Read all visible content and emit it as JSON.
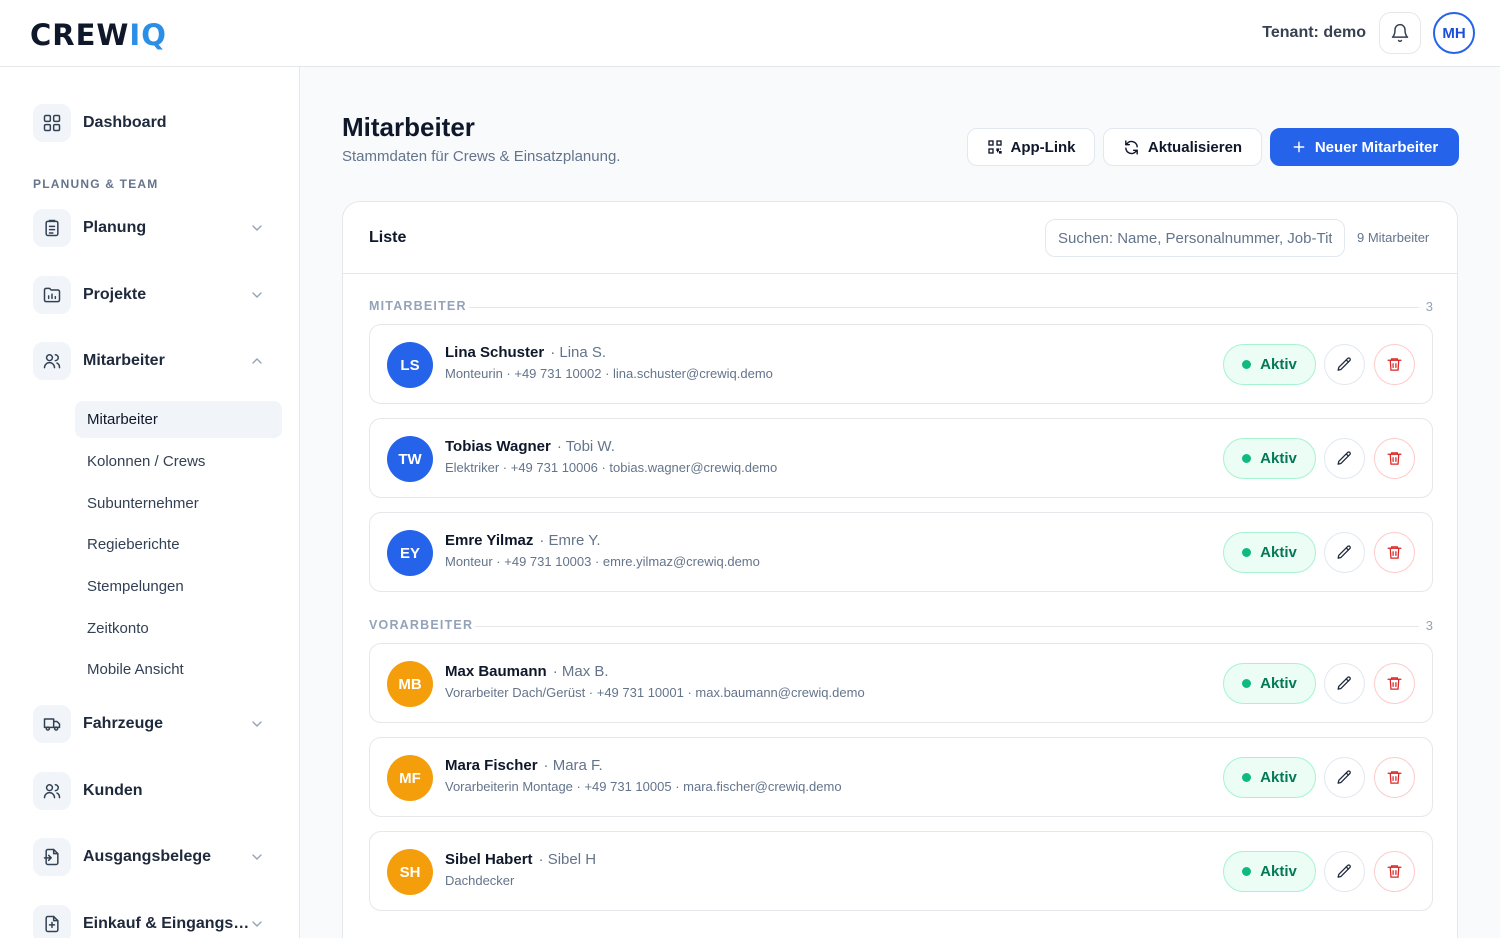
{
  "header": {
    "logo_part1": "CREW",
    "logo_part2": "IQ",
    "tenant": "Tenant: demo",
    "user_initials": "MH"
  },
  "sidebar": {
    "dashboard": "Dashboard",
    "section_label": "PLANUNG & TEAM",
    "items": [
      {
        "label": "Planung",
        "icon": "clipboard-icon"
      },
      {
        "label": "Projekte",
        "icon": "folder-chart-icon"
      },
      {
        "label": "Mitarbeiter",
        "icon": "users-icon",
        "expanded": true
      },
      {
        "label": "Fahrzeuge",
        "icon": "truck-icon"
      },
      {
        "label": "Kunden",
        "icon": "users-icon"
      },
      {
        "label": "Ausgangsbelege",
        "icon": "document-out-icon"
      },
      {
        "label": "Einkauf & Eingangsbel...",
        "icon": "document-in-icon"
      }
    ],
    "subitems": [
      "Mitarbeiter",
      "Kolonnen / Crews",
      "Subunternehmer",
      "Regieberichte",
      "Stempelungen",
      "Zeitkonto",
      "Mobile Ansicht"
    ]
  },
  "page": {
    "title": "Mitarbeiter",
    "subtitle": "Stammdaten für Crews & Einsatzplanung.",
    "btn_app_link": "App-Link",
    "btn_refresh": "Aktualisieren",
    "btn_new": "Neuer Mitarbeiter"
  },
  "list": {
    "title": "Liste",
    "search_placeholder": "Suchen: Name, Personalnummer, Job-Titel",
    "count": "9 Mitarbeiter",
    "groups": [
      {
        "label": "MITARBEITER",
        "count": "3",
        "rows": [
          {
            "initials": "LS",
            "name": "Lina Schuster",
            "nick": "· Lina S.",
            "meta": "Monteurin · +49 731 10002 · lina.schuster@crewiq.demo",
            "status": "Aktiv"
          },
          {
            "initials": "TW",
            "name": "Tobias Wagner",
            "nick": "· Tobi W.",
            "meta": "Elektriker · +49 731 10006 · tobias.wagner@crewiq.demo",
            "status": "Aktiv"
          },
          {
            "initials": "EY",
            "name": "Emre Yilmaz",
            "nick": "· Emre Y.",
            "meta": "Monteur · +49 731 10003 · emre.yilmaz@crewiq.demo",
            "status": "Aktiv"
          }
        ]
      },
      {
        "label": "VORARBEITER",
        "count": "3",
        "rows": [
          {
            "initials": "MB",
            "name": "Max Baumann",
            "nick": "· Max B.",
            "meta": "Vorarbeiter Dach/Gerüst · +49 731 10001 · max.baumann@crewiq.demo",
            "status": "Aktiv"
          },
          {
            "initials": "MF",
            "name": "Mara Fischer",
            "nick": "· Mara F.",
            "meta": "Vorarbeiterin Montage · +49 731 10005 · mara.fischer@crewiq.demo",
            "status": "Aktiv"
          },
          {
            "initials": "SH",
            "name": "Sibel Habert",
            "nick": "· Sibel H",
            "meta": "Dachdecker",
            "status": "Aktiv"
          }
        ]
      }
    ]
  },
  "colors": {
    "primary": "#2563eb",
    "avatar_blue": "#2563eb",
    "avatar_orange": "#f59e0b",
    "success": "#10b981",
    "danger": "#dc2626"
  }
}
